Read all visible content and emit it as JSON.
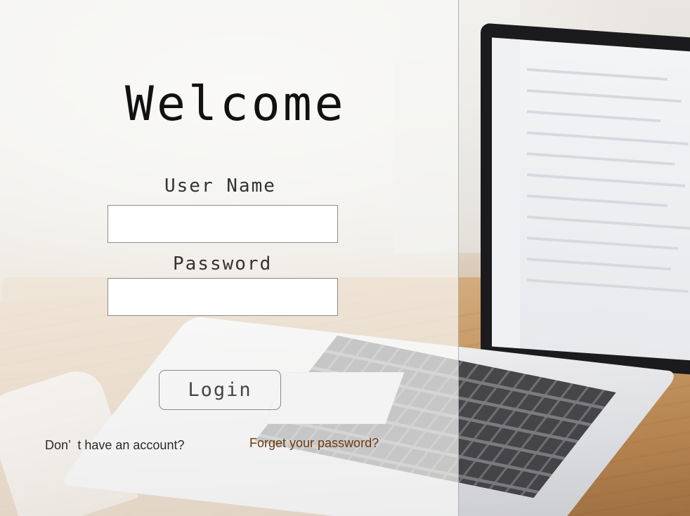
{
  "colors": {
    "panel_background": "#f8f8f6",
    "heading_text": "#111111",
    "label_text": "#333333",
    "field_border": "#8d8d8d",
    "forgot_link": "#6b3a0f",
    "signup_link": "#2a2a2a"
  },
  "login": {
    "heading": "Welcome",
    "username_label": "User Name",
    "username_value": "",
    "password_label": "Password",
    "password_value": "",
    "login_button": "Login",
    "signup_link": "Don’  t have an account?",
    "forgot_link": "Forget your password?"
  },
  "background": {
    "icon": "laptop-on-desk-photo"
  }
}
